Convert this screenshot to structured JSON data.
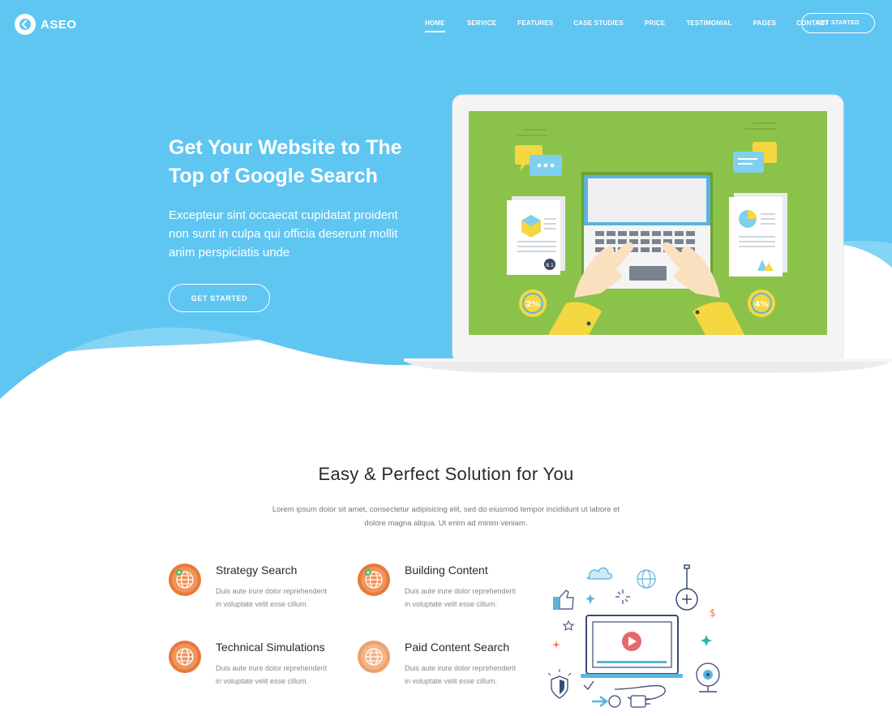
{
  "brand": {
    "name": "ASEO"
  },
  "nav": {
    "items": [
      {
        "label": "HOME",
        "active": true
      },
      {
        "label": "SERVICE",
        "active": false
      },
      {
        "label": "FEATURES",
        "active": false
      },
      {
        "label": "CASE STUDIES",
        "active": false
      },
      {
        "label": "PRICE",
        "active": false
      },
      {
        "label": "TESTIMONIAL",
        "active": false
      },
      {
        "label": "PAGES",
        "active": false
      },
      {
        "label": "CONTACT",
        "active": false
      }
    ],
    "cta_label": "GET STARTED"
  },
  "hero": {
    "title_line1": "Get Your Website to The",
    "title_line2": "Top of Google Search",
    "subtitle_line1": "Excepteur sint occaecat cupidatat proident",
    "subtitle_line2": "non sunt in culpa qui officia deserunt mollit",
    "subtitle_line3": "anim perspiciatis unde",
    "cta_label": "GET STARTED",
    "laptop_stats": {
      "left_percent": "2%",
      "right_percent": "4%",
      "badge": "8.1"
    }
  },
  "solution": {
    "title": "Easy & Perfect Solution for You",
    "desc_line1": "Lorem ipsum dolor sit amet, consectetur adipisicing elit, sed do eiusmod tempor incididunt ut labore et",
    "desc_line2": "dolore magna aliqua. Ut enim ad minim veniam.",
    "features": [
      {
        "title": "Strategy Search",
        "desc_line1": "Duis aute irure dolor reprehenderit",
        "desc_line2": "in voluptate velit esse cillum."
      },
      {
        "title": "Building Content",
        "desc_line1": "Duis aute irure dolor reprehenderit",
        "desc_line2": "in voluptate velit esse cillum."
      },
      {
        "title": "Technical Simulations",
        "desc_line1": "Duis aute irure dolor reprehenderit",
        "desc_line2": "in voluptate velit esse cillum."
      },
      {
        "title": "Paid Content Search",
        "desc_line1": "Duis aute irure dolor reprehenderit",
        "desc_line2": "in voluptate velit esse cillum."
      }
    ]
  },
  "colors": {
    "hero_blue": "#5fc6f2",
    "hero_blue_light": "#84d4f5",
    "screen_green": "#8bc34a",
    "icon_orange": "#e8793a",
    "accent_yellow": "#f5d742"
  },
  "icons": [
    "logo-icon",
    "globe-icon",
    "cloud-icon",
    "thumbs-up-icon",
    "play-icon",
    "shield-icon",
    "webcam-icon",
    "dollar-icon"
  ]
}
